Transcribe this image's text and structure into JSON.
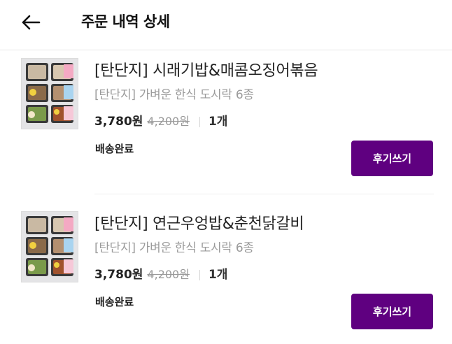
{
  "header": {
    "title": "주문 내역 상세"
  },
  "orders": [
    {
      "name": "[탄단지] 시래기밥&매콤오징어볶음",
      "sub_name": "[탄단지] 가벼운 한식 도시락 6종",
      "price": "3,780원",
      "original_price": "4,200원",
      "quantity": "1개",
      "status": "배송완료",
      "review_label": "후기쓰기"
    },
    {
      "name": "[탄단지] 연근우엉밥&춘천닭갈비",
      "sub_name": "[탄단지] 가벼운 한식 도시락 6종",
      "price": "3,780원",
      "original_price": "4,200원",
      "quantity": "1개",
      "status": "배송완료",
      "review_label": "후기쓰기"
    }
  ],
  "colors": {
    "accent": "#5f0080",
    "muted_text": "#9a9a9a"
  }
}
